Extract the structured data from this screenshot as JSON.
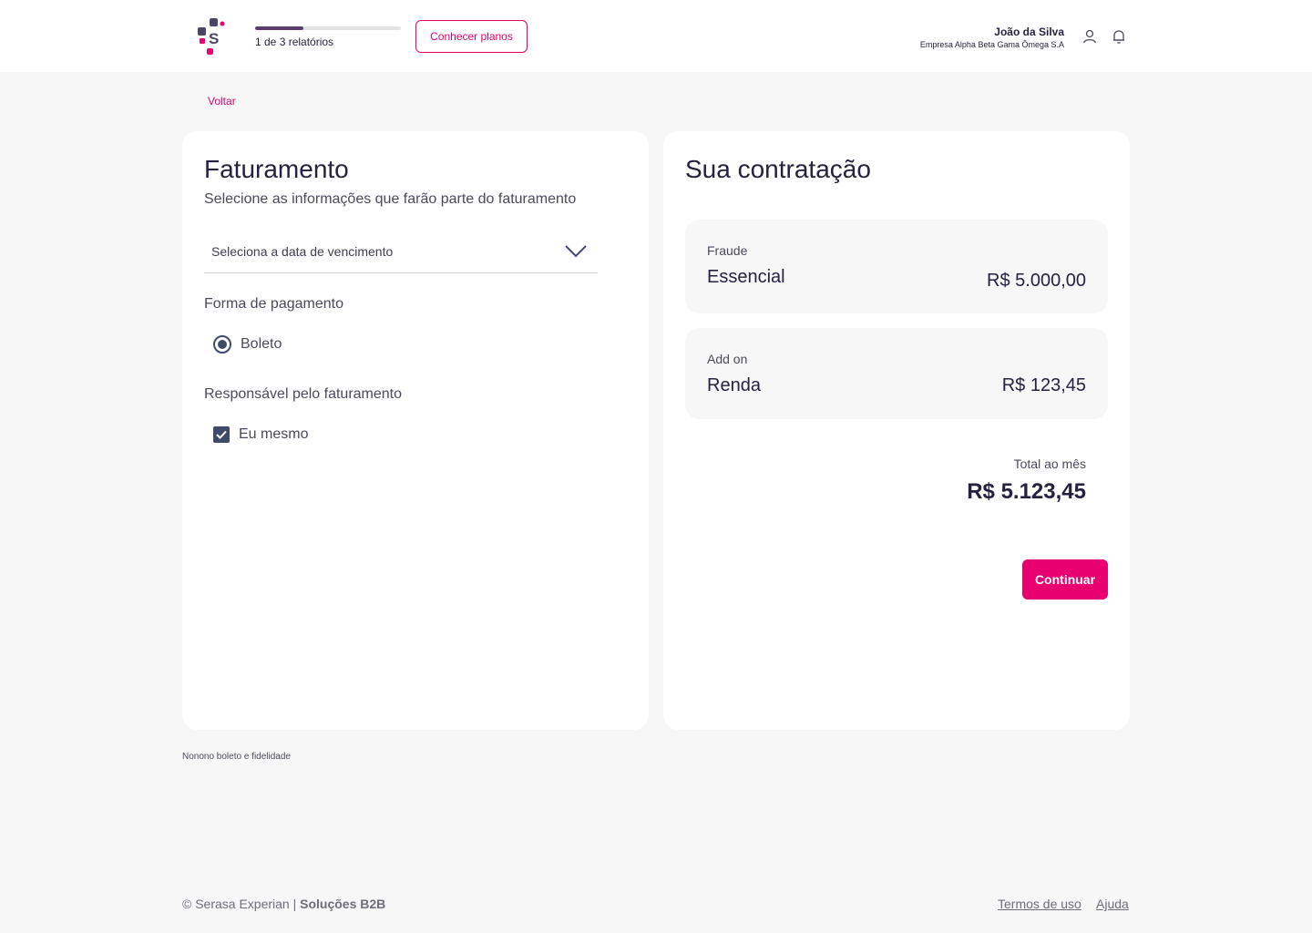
{
  "header": {
    "progress_text": "1 de 3 relatórios",
    "progress_fraction": 0.333,
    "plans_button": "Conhecer planos",
    "user_name": "João da Silva",
    "user_company": "Empresa Alpha Beta Gama Ômega S.A",
    "icons": [
      "user-icon",
      "bell-icon"
    ]
  },
  "nav": {
    "back": "Voltar"
  },
  "billing": {
    "title": "Faturamento",
    "subtitle": "Selecione as informações que farão parte do faturamento",
    "due_date_select": "Seleciona a data de vencimento",
    "payment_label": "Forma de pagamento",
    "payment_option": "Boleto",
    "payment_selected": true,
    "responsible_label": "Responsável pelo faturamento",
    "responsible_option": "Eu mesmo",
    "responsible_checked": true
  },
  "summary": {
    "title": "Sua contratação",
    "items": [
      {
        "category": "Fraude",
        "name": "Essencial",
        "price": "R$ 5.000,00"
      },
      {
        "category": "Add on",
        "name": "Renda",
        "price": "R$ 123,45"
      }
    ],
    "total_label": "Total ao mês",
    "total_value": "R$ 5.123,45",
    "continue_button": "Continuar"
  },
  "note": "Nonono boleto e fidelidade",
  "footer": {
    "copyright": "© Serasa Experian | ",
    "brand": "Soluções B2B",
    "terms": "Termos de uso",
    "help": "Ajuda"
  },
  "colors": {
    "accent": "#e80070",
    "dark": "#26213f",
    "control": "#3f4a6b",
    "background": "#f7f7f8"
  }
}
